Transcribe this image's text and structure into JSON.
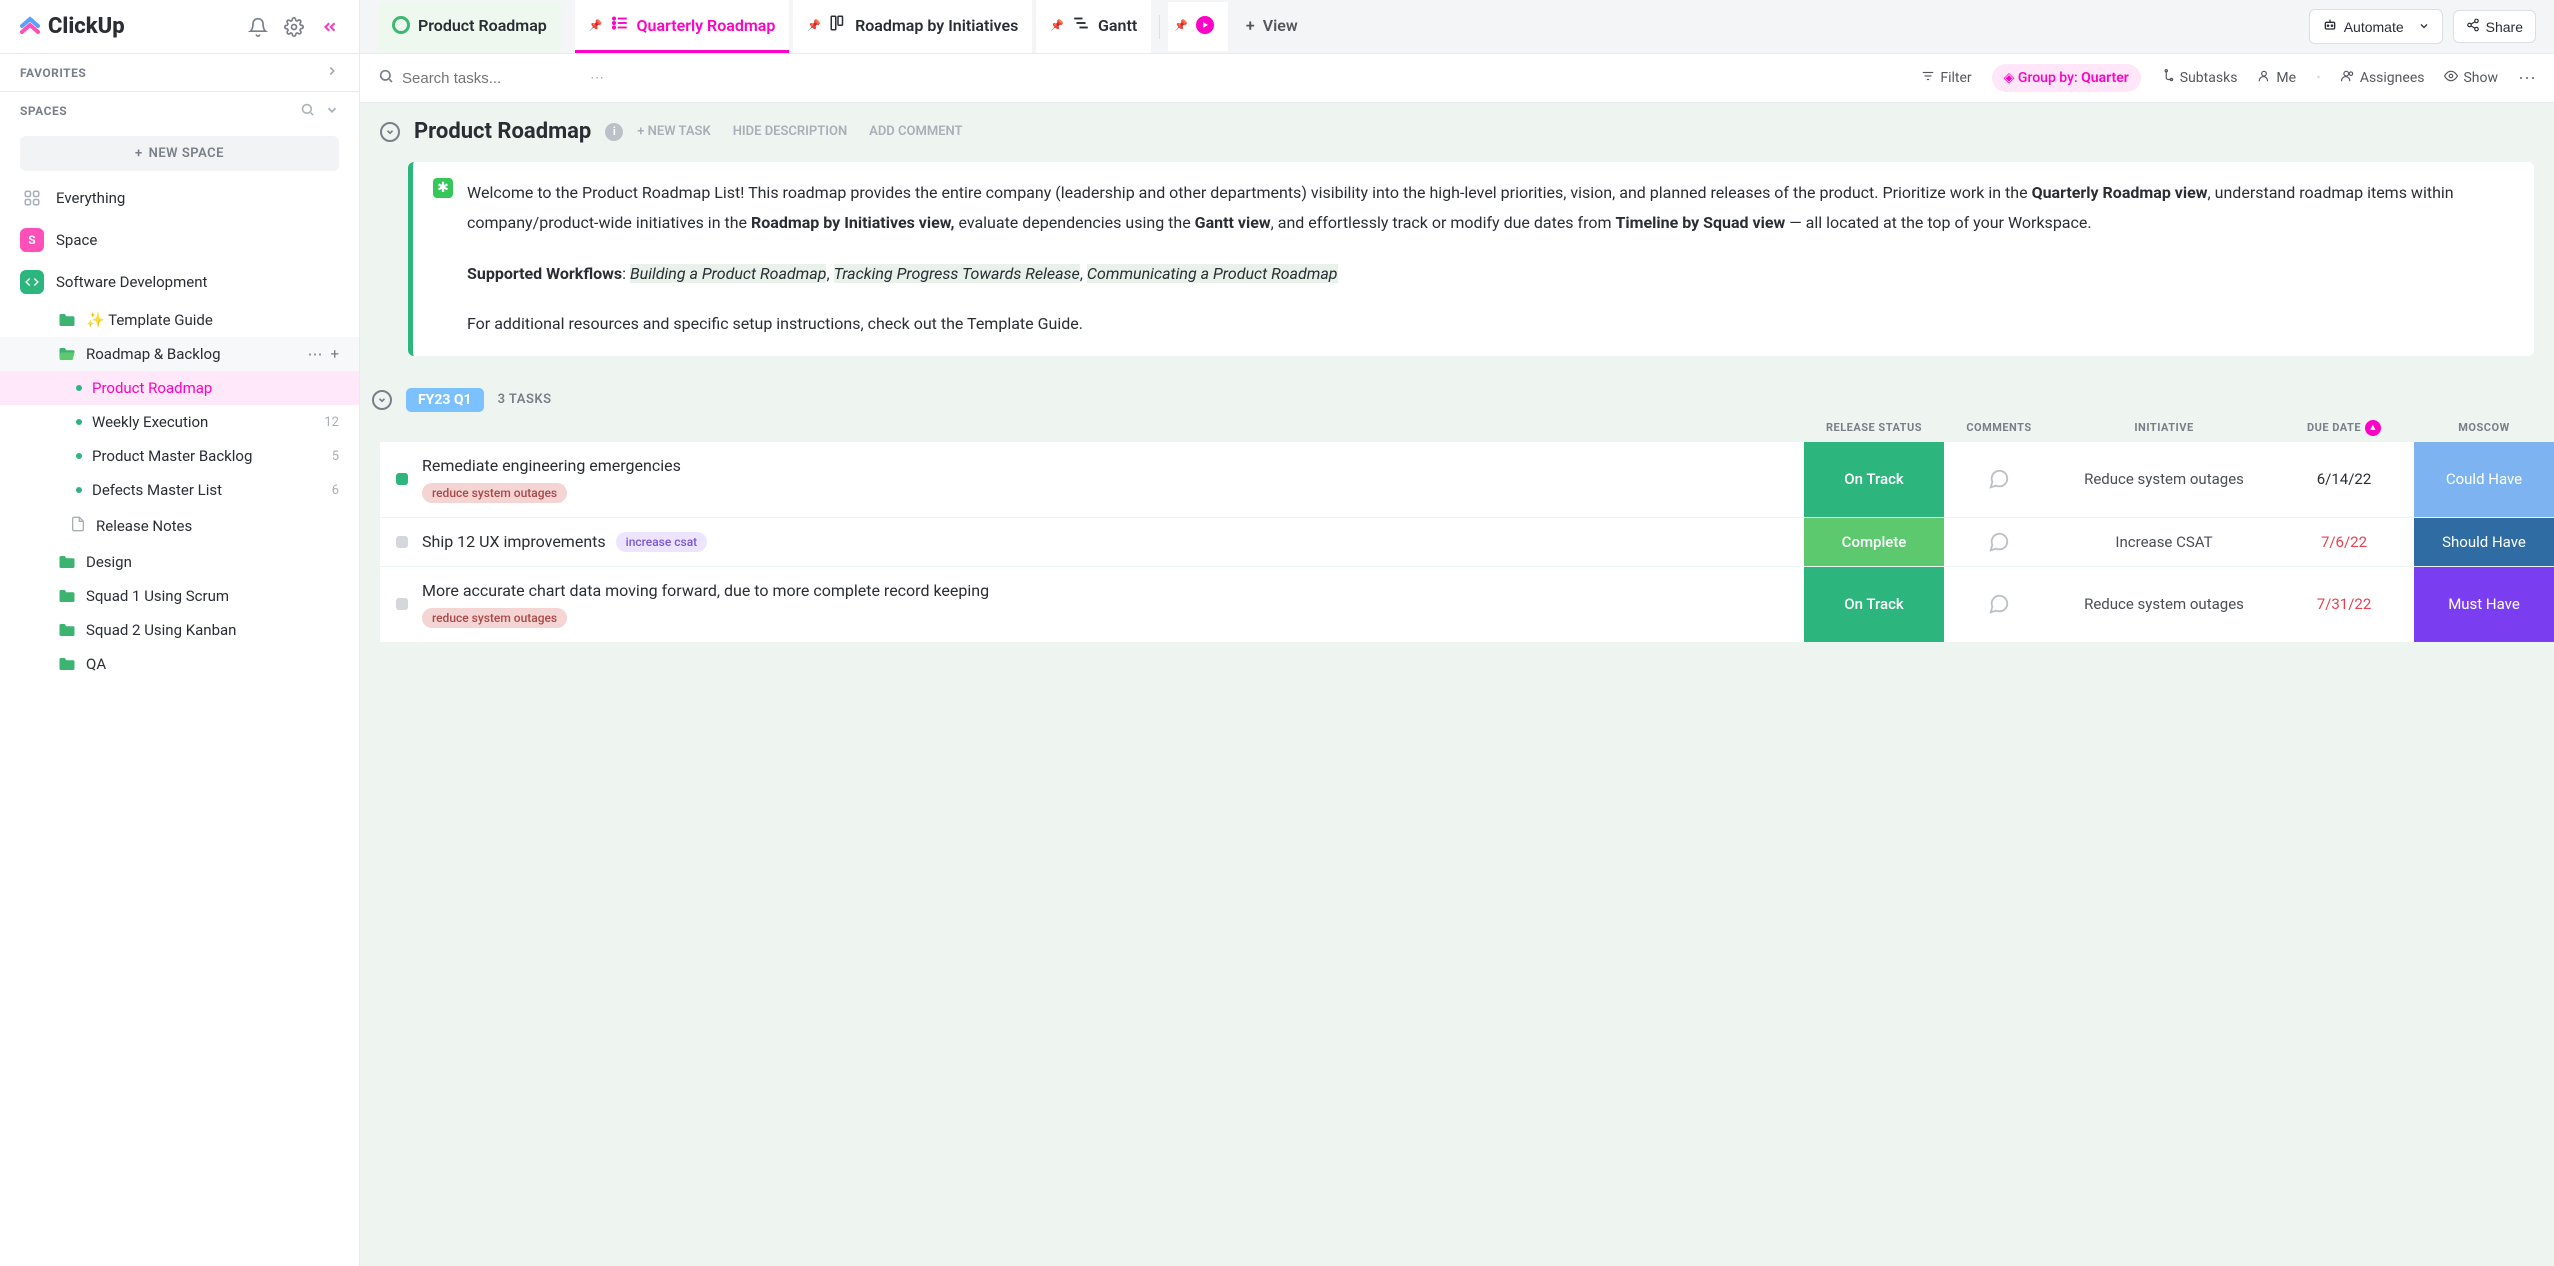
{
  "app": {
    "name": "ClickUp"
  },
  "sidebar": {
    "favorites_label": "FAVORITES",
    "spaces_label": "SPACES",
    "new_space_label": "NEW SPACE",
    "items": {
      "everything": "Everything",
      "space": "Space",
      "software_dev": "Software Development"
    },
    "tree": {
      "template_guide": "✨ Template Guide",
      "roadmap_backlog": "Roadmap & Backlog",
      "product_roadmap": "Product Roadmap",
      "weekly_execution": "Weekly Execution",
      "weekly_execution_count": "12",
      "product_master_backlog": "Product Master Backlog",
      "product_master_backlog_count": "5",
      "defects_master_list": "Defects Master List",
      "defects_master_list_count": "6",
      "release_notes": "Release Notes",
      "design": "Design",
      "squad1": "Squad 1 Using Scrum",
      "squad2": "Squad 2 Using Kanban",
      "qa": "QA"
    }
  },
  "tabs": {
    "space": "Product Roadmap",
    "quarterly": "Quarterly Roadmap",
    "initiatives": "Roadmap by Initiatives",
    "gantt": "Gantt",
    "view": "View",
    "automate": "Automate",
    "share": "Share"
  },
  "toolbar": {
    "search_placeholder": "Search tasks...",
    "filter": "Filter",
    "group_label": "Group by:",
    "group_value": "Quarter",
    "subtasks": "Subtasks",
    "me": "Me",
    "assignees": "Assignees",
    "show": "Show"
  },
  "list": {
    "title": "Product Roadmap",
    "new_task": "+ NEW TASK",
    "hide_desc": "HIDE DESCRIPTION",
    "add_comment": "ADD COMMENT",
    "desc_p1a": "Welcome to the Product Roadmap List! This roadmap provides the entire company (leadership and other departments) visibility into the high-level priorities, vision, and planned releases of the product. Prioritize work in the ",
    "desc_b1": "Quarterly Roadmap view",
    "desc_p1b": ", understand roadmap items within company/product-wide initiatives in the ",
    "desc_b2": "Roadmap by Initiatives view,",
    "desc_p1c": " evaluate dependencies using the ",
    "desc_b3": "Gantt view",
    "desc_p1d": ", and effortlessly track or modify due dates from ",
    "desc_b4": "Timeline by Squad view",
    "desc_p1e": " — all located at the top of your Workspace.",
    "desc_supported": "Supported Workflows",
    "desc_wf1": "Building a Product Roadmap",
    "desc_wf2": "Tracking Progress Towards Release",
    "desc_wf3": "Communicating a Product Roadmap",
    "desc_p3": "For additional resources and specific setup instructions, check out the Template Guide."
  },
  "group": {
    "label": "FY23 Q1",
    "count": "3 TASKS"
  },
  "columns": {
    "status": "RELEASE STATUS",
    "comments": "COMMENTS",
    "initiative": "INITIATIVE",
    "due": "DUE DATE",
    "moscow": "MOSCOW"
  },
  "tasks": [
    {
      "name": "Remediate engineering emergencies",
      "tag": "reduce system outages",
      "tag_class": "outage",
      "status": "On Track",
      "status_class": "status-ontrack",
      "initiative": "Reduce system outages",
      "due": "6/14/22",
      "due_overdue": false,
      "moscow": "Could Have",
      "moscow_class": "moscow-could",
      "check_green": true,
      "inline_tag": false
    },
    {
      "name": "Ship 12 UX improvements",
      "tag": "increase csat",
      "tag_class": "csat",
      "status": "Complete",
      "status_class": "status-complete",
      "initiative": "Increase CSAT",
      "due": "7/6/22",
      "due_overdue": true,
      "moscow": "Should Have",
      "moscow_class": "moscow-should",
      "check_green": false,
      "inline_tag": true
    },
    {
      "name": "More accurate chart data moving forward, due to more complete record keeping",
      "tag": "reduce system outages",
      "tag_class": "outage",
      "status": "On Track",
      "status_class": "status-ontrack",
      "initiative": "Reduce system outages",
      "due": "7/31/22",
      "due_overdue": true,
      "moscow": "Must Have",
      "moscow_class": "moscow-must",
      "check_green": false,
      "inline_tag": false
    }
  ]
}
